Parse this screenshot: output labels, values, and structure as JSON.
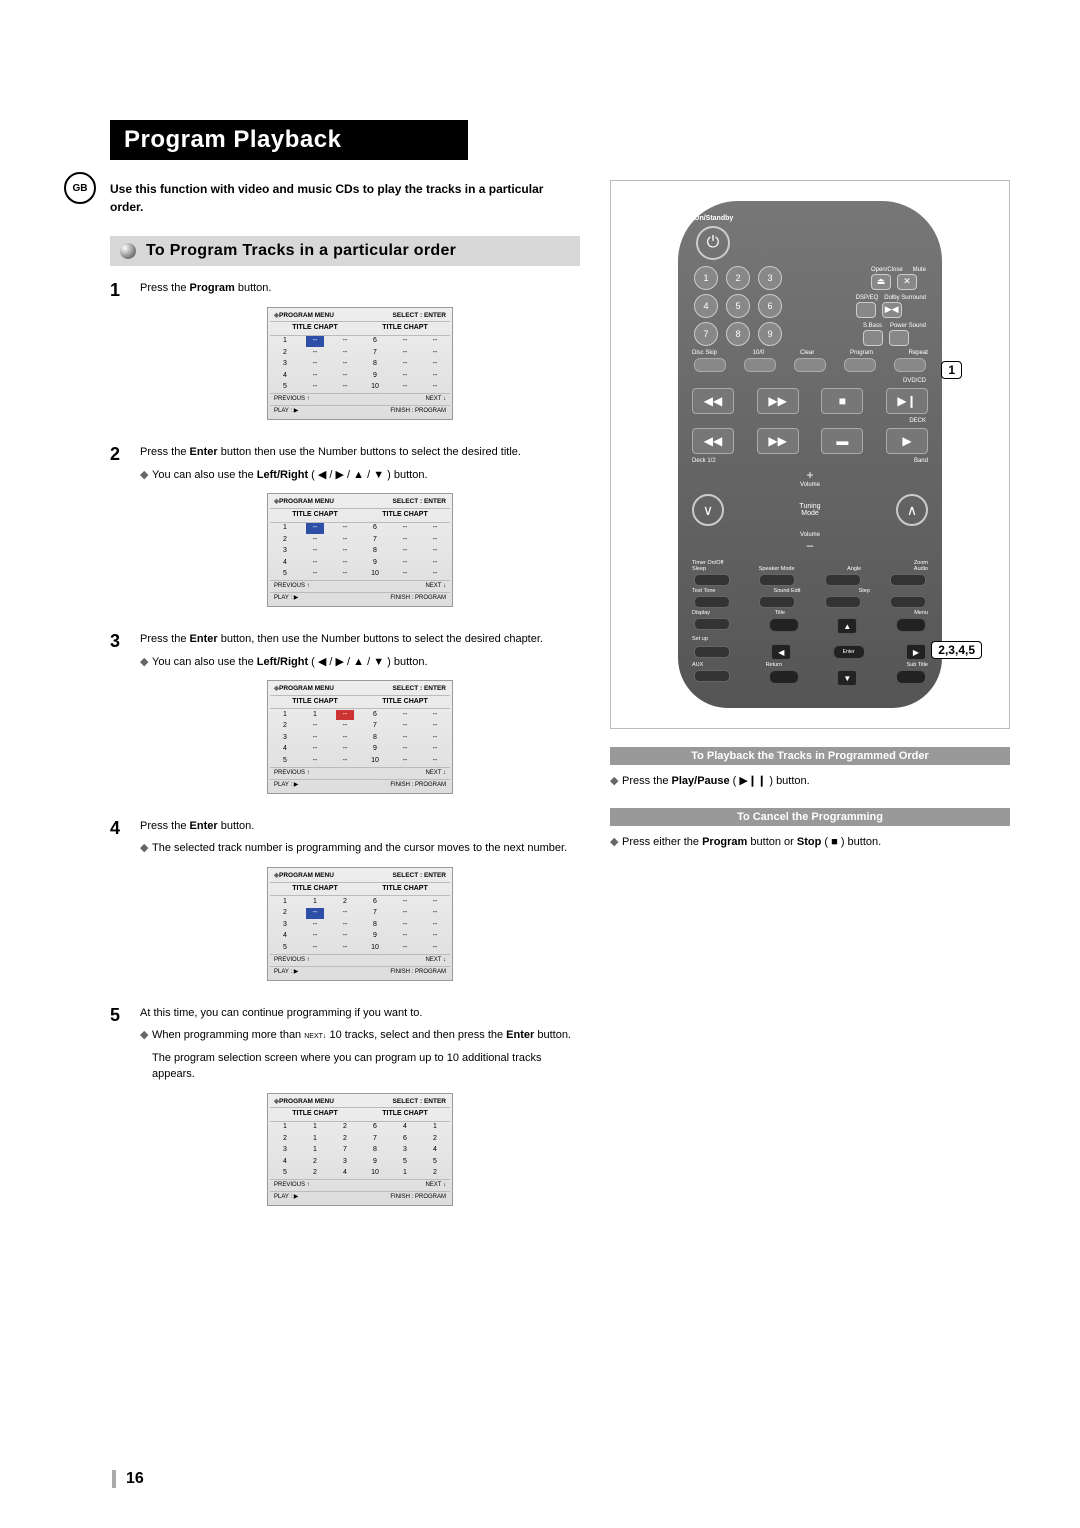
{
  "region": "GB",
  "title": "Program Playback",
  "intro": "Use this function with video and music CDs to play the tracks in a particular order.",
  "section": "To Program Tracks in a particular order",
  "steps": {
    "s1": {
      "num": "1",
      "text_a": "Press the ",
      "text_b": "Program",
      "text_c": " button."
    },
    "s2": {
      "num": "2",
      "text_a": "Press the ",
      "text_b": "Enter",
      "text_c": " button then use the Number buttons to select the desired title.",
      "sub": "You can also use the ",
      "sub_b": "Left/Right",
      "sub_c": " ( ◀ / ▶ / ▲ / ▼ ) button."
    },
    "s3": {
      "num": "3",
      "text_a": "Press the ",
      "text_b": "Enter",
      "text_c": " button, then use the Number buttons to select the desired chapter.",
      "sub": "You can also use the ",
      "sub_b": "Left/Right",
      "sub_c": " ( ◀ / ▶ / ▲ / ▼ ) button."
    },
    "s4": {
      "num": "4",
      "text_a": "Press the ",
      "text_b": "Enter",
      "text_c": " button.",
      "sub": "The selected track number is programming and the cursor moves to the next number."
    },
    "s5": {
      "num": "5",
      "text": "At this time, you can continue programming if you want to.",
      "sub1_a": "When programming more than ",
      "sub1_next": "NEXT↓",
      "sub1_b": " 10 tracks, select and then press the ",
      "sub1_c": "Enter",
      "sub1_d": " button.",
      "sub2": "The program selection screen where you can program up to 10 additional tracks appears."
    }
  },
  "menu": {
    "title_l": "PROGRAM MENU",
    "title_r": "SELECT : ENTER",
    "col": "TITLE CHAPT",
    "prev": "PREVIOUS ↑",
    "next": "NEXT ↓",
    "play": "PLAY : ▶",
    "finish": "FINISH : PROGRAM",
    "dash": "--"
  },
  "menu_rows": {
    "m1": [
      [
        "1",
        "--",
        "--",
        "6",
        "--",
        "--"
      ],
      [
        "2",
        "--",
        "--",
        "7",
        "--",
        "--"
      ],
      [
        "3",
        "--",
        "--",
        "8",
        "--",
        "--"
      ],
      [
        "4",
        "--",
        "--",
        "9",
        "--",
        "--"
      ],
      [
        "5",
        "--",
        "--",
        "10",
        "--",
        "--"
      ]
    ],
    "m2": [
      [
        "1",
        "--",
        "--",
        "6",
        "--",
        "--"
      ],
      [
        "2",
        "--",
        "--",
        "7",
        "--",
        "--"
      ],
      [
        "3",
        "--",
        "--",
        "8",
        "--",
        "--"
      ],
      [
        "4",
        "--",
        "--",
        "9",
        "--",
        "--"
      ],
      [
        "5",
        "--",
        "--",
        "10",
        "--",
        "--"
      ]
    ],
    "m3": [
      [
        "1",
        "1",
        "--",
        "6",
        "--",
        "--"
      ],
      [
        "2",
        "--",
        "--",
        "7",
        "--",
        "--"
      ],
      [
        "3",
        "--",
        "--",
        "8",
        "--",
        "--"
      ],
      [
        "4",
        "--",
        "--",
        "9",
        "--",
        "--"
      ],
      [
        "5",
        "--",
        "--",
        "10",
        "--",
        "--"
      ]
    ],
    "m4": [
      [
        "1",
        "1",
        "2",
        "6",
        "--",
        "--"
      ],
      [
        "2",
        "--",
        "--",
        "7",
        "--",
        "--"
      ],
      [
        "3",
        "--",
        "--",
        "8",
        "--",
        "--"
      ],
      [
        "4",
        "--",
        "--",
        "9",
        "--",
        "--"
      ],
      [
        "5",
        "--",
        "--",
        "10",
        "--",
        "--"
      ]
    ],
    "m5": [
      [
        "1",
        "1",
        "2",
        "6",
        "4",
        "1"
      ],
      [
        "2",
        "1",
        "2",
        "7",
        "6",
        "2"
      ],
      [
        "3",
        "1",
        "7",
        "8",
        "3",
        "4"
      ],
      [
        "4",
        "2",
        "3",
        "9",
        "5",
        "5"
      ],
      [
        "5",
        "2",
        "4",
        "10",
        "1",
        "2"
      ]
    ]
  },
  "remote": {
    "on_standby": "On/Standby",
    "open_close": "Open/Close",
    "mute": "Mute",
    "dsp": "DSP/EQ",
    "dolby": "Dolby Surround",
    "sbass": "S.Bass",
    "power": "Power Sound",
    "disc_skip": "Disc Skip",
    "ten": "10/0",
    "clear": "Clear",
    "program": "Program",
    "repeat": "Repeat",
    "dvd": "DVD/CD",
    "deck": "DECK",
    "deck12": "Deck 1/2",
    "band": "Band",
    "vol_p": "+",
    "vol": "Volume",
    "vol_m": "–",
    "tuning": "Tuning",
    "mode": "Mode",
    "timer": "Timer On/Off",
    "zoom": "Zoom",
    "sleep": "Sleep",
    "speaker": "Speaker Mode",
    "angle": "Angle",
    "audio": "Audio",
    "test": "Test Tone",
    "sound": "Sound Edit",
    "step": "Step",
    "display": "Display",
    "title": "Title",
    "menu_l": "Menu",
    "setup": "Set up",
    "enter": "Enter",
    "return": "Return",
    "subt": "Sub Title",
    "aux": "AUX"
  },
  "callouts": {
    "c1": "1",
    "c2": "2,3,4,5"
  },
  "right": {
    "h1": "To Playback the Tracks in Programmed Order",
    "b1_a": "Press the ",
    "b1_b": "Play/Pause",
    "b1_c": " ( ▶❙❙ ) button.",
    "h2": "To Cancel the Programming",
    "b2_a": "Press either the ",
    "b2_b": "Program",
    "b2_c": " button or ",
    "b2_d": "Stop",
    "b2_e": " ( ■ ) button."
  },
  "page_number": "16"
}
